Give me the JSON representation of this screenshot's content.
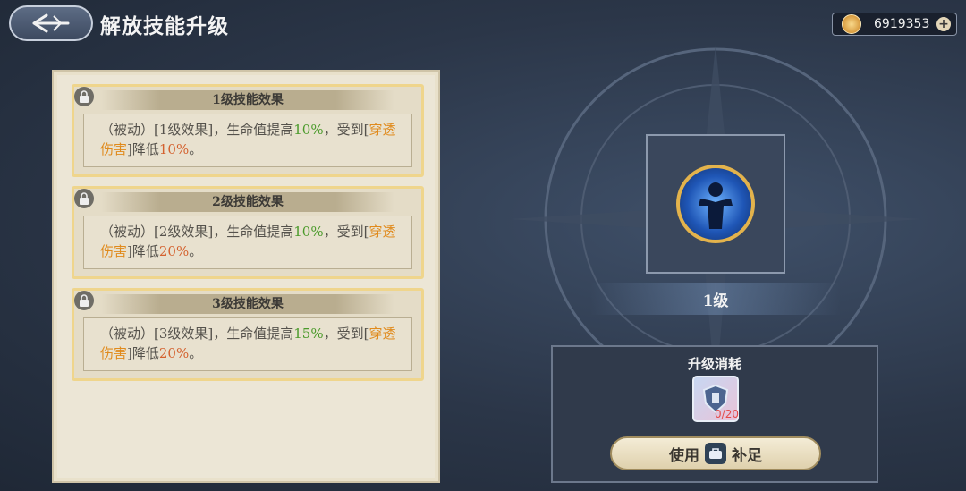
{
  "header": {
    "title": "解放技能升级"
  },
  "currency": {
    "amount": "6919353",
    "icon": "coin-icon",
    "add_icon": "plus-icon"
  },
  "effects": [
    {
      "header": "1级技能效果",
      "prefix": "（被动）[1级效果]，生命值提高",
      "hp": "10%",
      "mid": "，受到[",
      "damage_type": "穿透伤害",
      "suffix": "]降低",
      "reduce": "10%",
      "end": "。",
      "locked": true
    },
    {
      "header": "2级技能效果",
      "prefix": "（被动）[2级效果]，生命值提高",
      "hp": "10%",
      "mid": "，受到[",
      "damage_type": "穿透伤害",
      "suffix": "]降低",
      "reduce": "20%",
      "end": "。",
      "locked": true
    },
    {
      "header": "3级技能效果",
      "prefix": "（被动）[3级效果]，生命值提高",
      "hp": "15%",
      "mid": "，受到[",
      "damage_type": "穿透伤害",
      "suffix": "]降低",
      "reduce": "20%",
      "end": "。",
      "locked": true
    }
  ],
  "skill": {
    "level_label": "1级",
    "icon": "skill-icon"
  },
  "cost": {
    "title": "升级消耗",
    "item_count": "0/20",
    "button_prefix": "使用",
    "button_suffix": "补足"
  },
  "colors": {
    "accent_green": "#4a9a2a",
    "accent_orange": "#e08a1c",
    "accent_red": "#d4612e"
  }
}
